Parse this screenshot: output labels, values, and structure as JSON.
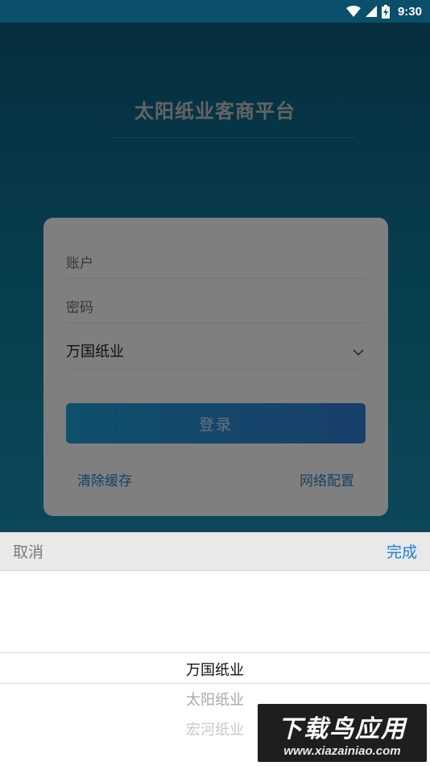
{
  "status_bar": {
    "time": "9:30",
    "icons": [
      "wifi-icon",
      "signal-icon",
      "battery-charging-icon"
    ]
  },
  "app": {
    "title": "太阳纸业客商平台"
  },
  "login_form": {
    "account_placeholder": "账户",
    "password_placeholder": "密码",
    "company_selected": "万国纸业",
    "login_button": "登录",
    "clear_cache_link": "清除缓存",
    "network_config_link": "网络配置"
  },
  "picker": {
    "cancel_label": "取消",
    "done_label": "完成",
    "options": [
      "万国纸业",
      "太阳纸业",
      "宏河纸业"
    ],
    "selected_index": 0
  },
  "watermark": {
    "top": "下载鸟应用",
    "bottom": "www.xiazainiao.com"
  },
  "colors": {
    "background_top": "#0c5b79",
    "background_bottom": "#1a8fb3",
    "accent": "#1f7fe0",
    "button": "#2d8bd6"
  }
}
